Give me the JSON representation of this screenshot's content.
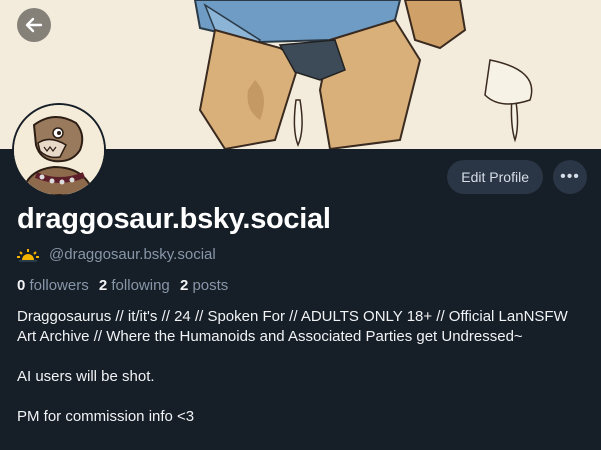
{
  "profile": {
    "display_name": "draggosaur.bsky.social",
    "handle": "@draggosaur.bsky.social",
    "followers_count": "0",
    "followers_label": "followers",
    "following_count": "2",
    "following_label": "following",
    "posts_count": "2",
    "posts_label": "posts",
    "bio": [
      "Draggosaurus // it/it's // 24 // Spoken For // ADULTS ONLY 18+ // Official LanNSFW Art Archive // Where the Humanoids and Associated Parties get Undressed~",
      "AI users will be shot.",
      "PM for commission info <3"
    ]
  },
  "actions": {
    "edit_profile_label": "Edit Profile",
    "more_label": "•••"
  },
  "icons": {
    "back": "arrow-left-icon",
    "handle_badge": "sunrise-icon"
  },
  "colors": {
    "background": "#161e27",
    "button_bg": "#2a3545",
    "muted_text": "#8796a8",
    "badge_yellow": "#f2b400"
  }
}
